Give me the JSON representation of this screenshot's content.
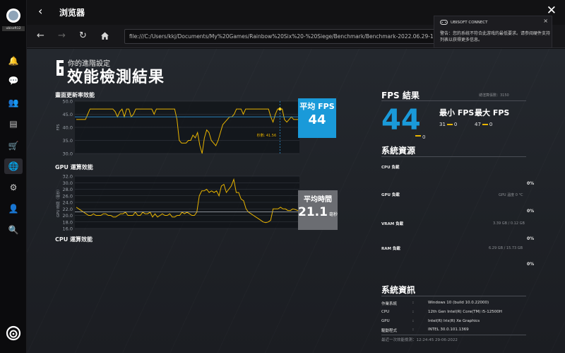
{
  "sidebar": {
    "username": "ubisoft12",
    "icons": [
      "bell-icon",
      "chat-icon",
      "friends-icon",
      "news-icon",
      "store-icon",
      "browser-icon",
      "settings-icon",
      "account-icon",
      "search-icon"
    ]
  },
  "topbar": {
    "back_glyph": "‹",
    "title": "浏览器",
    "close_glyph": "✕"
  },
  "navbar": {
    "back_glyph": "←",
    "forward_glyph": "→",
    "reload_glyph": "↻",
    "url": "file:///C:/Users/kkj/Documents/My%20Games/Rainbow%20Six%20-%20Siege/Benchmark/Benchmark-2022.06.29-12.24.48.html"
  },
  "notification": {
    "brand": "UBISOFT CONNECT",
    "close_glyph": "×",
    "body": "警告：您的系统不符合此游戏的最低要求。请参阅硬件支持列表以获得更多信息。"
  },
  "page": {
    "subtitle": "你的進階設定",
    "title": "效能檢測結果",
    "fps_chart_label": "畫面更新率效能",
    "gpu_chart_label": "GPU 運算效能",
    "cpu_chart_label": "CPU 運算效能"
  },
  "fps_chart": {
    "ylabel": "FPS",
    "ylim": [
      30,
      50
    ],
    "yticks": [
      "50.0",
      "45.0",
      "40.0",
      "35.0",
      "30.0"
    ],
    "average": 44,
    "marker_label": "秒數: 41.56",
    "values": [
      43,
      43,
      43,
      43,
      43,
      45,
      47,
      47,
      47,
      47,
      47,
      47,
      47,
      47,
      47,
      47,
      47,
      46,
      44,
      46,
      47,
      44,
      47,
      47,
      44,
      45,
      47,
      47,
      47,
      47,
      47,
      47,
      47,
      47,
      45,
      47,
      47,
      47,
      47,
      47,
      47,
      47,
      47,
      47,
      43,
      35,
      34,
      34,
      34,
      35,
      35,
      37,
      36,
      38,
      33,
      30,
      36,
      39,
      38,
      35,
      34,
      33,
      35,
      38,
      41,
      42,
      43,
      44,
      44,
      45,
      47,
      47,
      47,
      45,
      47,
      47,
      47,
      47,
      47,
      47,
      47,
      47,
      47,
      47,
      47,
      44,
      42,
      45,
      47,
      47,
      47,
      43,
      42,
      43,
      44,
      43,
      43,
      43,
      44,
      43,
      43
    ]
  },
  "gpu_chart": {
    "ylabel": "GPU 時間（毫秒）",
    "ylim": [
      16,
      32
    ],
    "yticks": [
      "32.0",
      "30.0",
      "28.0",
      "26.0",
      "24.0",
      "22.0",
      "20.0",
      "18.0",
      "16.0"
    ],
    "average": 21.1,
    "values": [
      22.5,
      22,
      21.5,
      21,
      20.5,
      20,
      20,
      20.5,
      20,
      20,
      20,
      20.5,
      20.5,
      20,
      20,
      19.5,
      19.5,
      20,
      20.5,
      20.5,
      21,
      20,
      20,
      20,
      21,
      20,
      20,
      21,
      20.5,
      20.5,
      21,
      19.5,
      20.5,
      19.5,
      20,
      20.5,
      20,
      20,
      20.5,
      19.5,
      19.5,
      20,
      20,
      21,
      20.5,
      21,
      20.5,
      20,
      20,
      21,
      26,
      27.5,
      27.5,
      28,
      27,
      27.5,
      27,
      27.5,
      26,
      29,
      29.5,
      27,
      28,
      29,
      31,
      27,
      27,
      25,
      24.5,
      22,
      21,
      20.5,
      20,
      19.5,
      19,
      18.5,
      18,
      17.8,
      18,
      18.5,
      22,
      22,
      22,
      22.5,
      22,
      22,
      21.5,
      21.5,
      22,
      21.8,
      21.5,
      21.6,
      21.7,
      21.5
    ]
  },
  "cards": {
    "fps_label": "平均 FPS",
    "fps_value": "44",
    "avg_time_label": "平均時間",
    "avg_time_value": "21.1",
    "avg_time_unit": "毫秒"
  },
  "right": {
    "fps_title": "FPS 結果",
    "total_frames": "總渲算張數：3150",
    "fps_value": "44",
    "fps_zero": "0",
    "min_label": "最小 FPS",
    "max_label": "最大 FPS",
    "min_value": "31",
    "min_zero": "0",
    "max_value": "47",
    "max_zero": "0",
    "sys_res_title": "系統資源",
    "cpu_load": "CPU 負載",
    "cpu_pct": "0%",
    "gpu_load": "GPU 負載",
    "gpu_temp": "GPU 溫度 0 °C",
    "gpu_pct": "0%",
    "vram_load": "VRAM 負載",
    "vram_info": "3.39 GB / 0.12 GB",
    "vram_pct": "0%",
    "ram_load": "RAM 負載",
    "ram_info": "6.29 GB / 15.73 GB",
    "ram_pct": "0%",
    "sys_info_title": "系統資訊",
    "os_key": "作業系統",
    "os_val": "Windows 10 (build 10.0.22000)",
    "cpu_key": "CPU",
    "cpu_val": "12th Gen Intel(R) Core(TM) i5-12500H",
    "gpu_key": "GPU",
    "gpu_val": "Intel(R) Iris(R) Xe Graphics",
    "driver_key": "驅動程式",
    "driver_val": "INTEL 30.0.101.1369",
    "colon": ":",
    "footer": "最近一次效能檢測：12:24:45 29-06-2022"
  },
  "colors": {
    "accent_blue": "#1a9ad9",
    "series_yellow": "#e8b400",
    "avg_line": "#2a8fd0"
  }
}
